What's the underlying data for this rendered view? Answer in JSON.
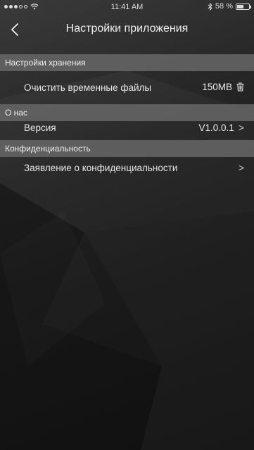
{
  "status_bar": {
    "time": "11:41 AM",
    "battery_label": "58 %",
    "battery_level": 0.58,
    "signal_bars": 3,
    "signal_total": 5,
    "icons": [
      "signal-dots-icon",
      "wifi-icon",
      "bluetooth-icon",
      "battery-icon"
    ]
  },
  "nav": {
    "title": "Настройки приложения",
    "back_icon": "chevron-left-icon"
  },
  "sections": {
    "storage": {
      "header": "Настройки хранения",
      "row_label": "Очистить временные файлы",
      "row_value": "150MB",
      "row_icon": "trash-icon"
    },
    "about": {
      "header": "О нас",
      "row_label": "Версия",
      "row_value": "V1.0.0.1",
      "row_icon": "chevron-right-icon"
    },
    "privacy": {
      "header": "Конфиденциальность",
      "row_label": "Заявление о конфиденциальности",
      "row_icon": "chevron-right-icon"
    }
  },
  "colors": {
    "section_header_bg": "#6a6a6a",
    "background_dark": "#1a1a1a",
    "text": "#e8e8e8"
  }
}
